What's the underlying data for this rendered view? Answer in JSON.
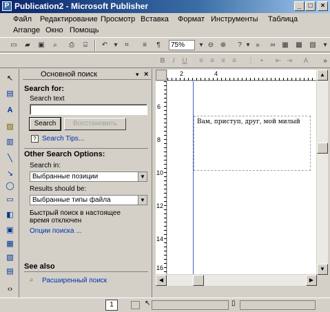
{
  "window": {
    "title": "Publication2 - Microsoft Publisher",
    "app_icon": "publisher-icon",
    "minimize": "_",
    "maximize": "□",
    "close": "×"
  },
  "menu": {
    "row1": [
      "Файл",
      "Редактирование",
      "Просмотр",
      "Вставка",
      "Формат",
      "Инструменты",
      "Таблица"
    ],
    "row2": [
      "Arrange",
      "Окно",
      "Помощь"
    ]
  },
  "toolbar": {
    "zoom": "75%"
  },
  "task_pane": {
    "title": "Основной поиск",
    "search_for": "Search for:",
    "search_text_label": "Search text",
    "search_text_value": "",
    "search_button": "Search",
    "restore_button": "Восстановить",
    "search_tips": "Search Tips...",
    "other_options": "Other Search Options:",
    "search_in_label": "Search in:",
    "search_in_value": "Выбранные позиции",
    "results_label": "Results should be:",
    "results_value": "Выбранные типы файла",
    "fast_search_note": "Быстрый поиск в настоящее время отключен",
    "search_options_link": "Опции поиска ...",
    "see_also": "See also",
    "advanced_search": "Расширенный поиск"
  },
  "document": {
    "textbox_text": "Вам, приступ, друг, мой милый",
    "ruler_h": [
      "2",
      "4"
    ],
    "ruler_v": [
      "6",
      "8",
      "10",
      "12",
      "14",
      "16"
    ]
  },
  "status": {
    "page_number": "1"
  }
}
